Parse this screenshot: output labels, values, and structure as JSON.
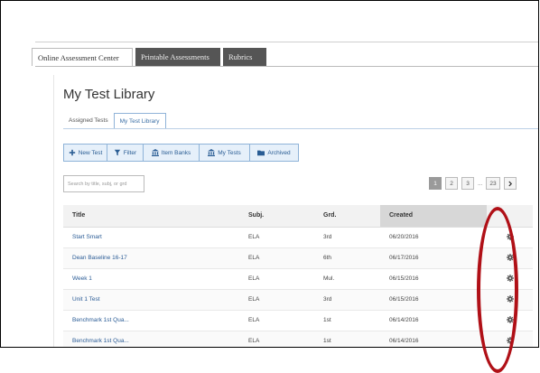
{
  "nav_tabs": [
    {
      "label": "Online Assessment Center",
      "active": true
    },
    {
      "label": "Printable Assessments",
      "active": false
    },
    {
      "label": "Rubrics",
      "active": false
    }
  ],
  "page_title": "My Test Library",
  "sub_tabs": [
    {
      "label": "Assigned Tests",
      "active": false
    },
    {
      "label": "My Test Library",
      "active": true
    }
  ],
  "toolbar": {
    "new_test": "New Test",
    "filter": "Filter",
    "item_banks": "Item Banks",
    "my_tests": "My Tests",
    "archived": "Archived"
  },
  "search": {
    "placeholder": "Search by title, subj, or grd"
  },
  "pagination": {
    "pages": [
      "1",
      "2",
      "3"
    ],
    "ellipsis": "...",
    "last": "23",
    "current": "1"
  },
  "table": {
    "headers": {
      "title": "Title",
      "subj": "Subj.",
      "grd": "Grd.",
      "created": "Created"
    },
    "rows": [
      {
        "title": "Start Smart",
        "subj": "ELA",
        "grd": "3rd",
        "created": "06/20/2016"
      },
      {
        "title": "Dean Baseline 16-17",
        "subj": "ELA",
        "grd": "6th",
        "created": "06/17/2016"
      },
      {
        "title": "Week 1",
        "subj": "ELA",
        "grd": "Mul.",
        "created": "06/15/2016"
      },
      {
        "title": "Unit 1 Test",
        "subj": "ELA",
        "grd": "3rd",
        "created": "06/15/2016"
      },
      {
        "title": "Benchmark 1st Qua...",
        "subj": "ELA",
        "grd": "1st",
        "created": "06/14/2016"
      },
      {
        "title": "Benchmark 1st Qua...",
        "subj": "ELA",
        "grd": "1st",
        "created": "06/14/2016"
      }
    ]
  },
  "colors": {
    "accent": "#2a5d94",
    "highlight_oval": "#b01017",
    "dark_tab": "#555555"
  },
  "icons": {
    "row_action": "gear-icon",
    "new_test": "plus-icon",
    "filter": "filter-icon",
    "item_banks": "bank-icon",
    "my_tests": "bank-icon",
    "archived": "folder-icon",
    "pager_next": "chevron-right-icon"
  }
}
